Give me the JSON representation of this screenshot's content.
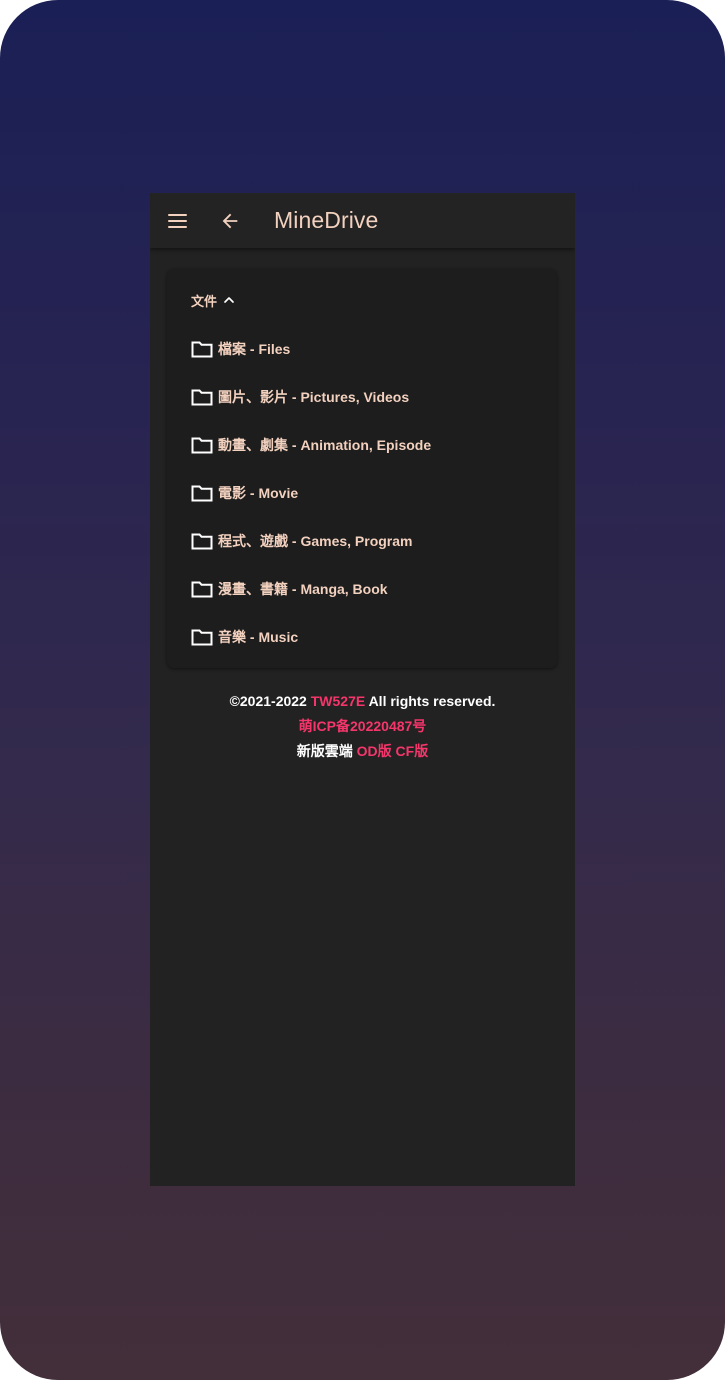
{
  "header": {
    "title": "MineDrive",
    "menu_icon": "hamburger-menu-icon",
    "back_icon": "arrow-left-icon"
  },
  "section": {
    "label": "文件",
    "toggle_icon": "chevron-up-icon",
    "folders": [
      {
        "label": "檔案 - Files",
        "icon": "folder-icon"
      },
      {
        "label": "圖片、影片 - Pictures, Videos",
        "icon": "folder-icon"
      },
      {
        "label": "動畫、劇集 - Animation, Episode",
        "icon": "folder-icon"
      },
      {
        "label": "電影 - Movie",
        "icon": "folder-icon"
      },
      {
        "label": "程式、遊戲 - Games, Program",
        "icon": "folder-icon"
      },
      {
        "label": "漫畫、書籍 - Manga, Book",
        "icon": "folder-icon"
      },
      {
        "label": "音樂 - Music",
        "icon": "folder-icon"
      }
    ]
  },
  "footer": {
    "copyright_prefix": "©2021-2022 ",
    "author": "TW527E",
    "copyright_suffix": " All rights reserved.",
    "icp": "萌ICP备20220487号",
    "new_version_prefix": "新版雲端 ",
    "od_link": "OD版",
    "cf_link": "CF版"
  },
  "colors": {
    "text_primary": "#f3d1bf",
    "accent": "#f5366b",
    "surface": "#222222",
    "card": "#1d1d1d"
  }
}
